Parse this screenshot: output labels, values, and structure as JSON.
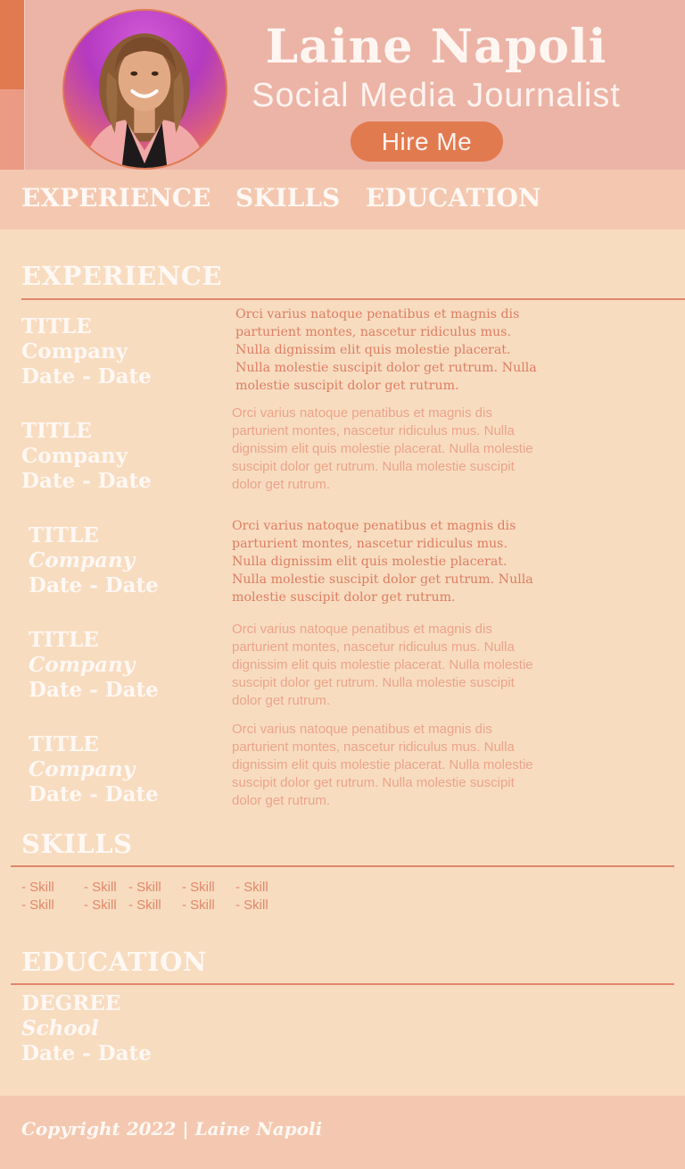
{
  "header": {
    "name": "Laine Napoli",
    "role": "Social Media Journalist",
    "hire_label": "Hire Me",
    "avatar_icon": "profile-photo"
  },
  "nav": {
    "items": [
      {
        "label": "EXPERIENCE"
      },
      {
        "label": "SKILLS"
      },
      {
        "label": "EDUCATION"
      }
    ]
  },
  "experience": {
    "title": "EXPERIENCE",
    "jobs": [
      {
        "title": "TITLE",
        "company": "Company",
        "dates": "Date - Date",
        "description": "Orci varius natoque penatibus et magnis dis parturient montes, nascetur ridiculus mus. Nulla dignissim elit quis molestie placerat. Nulla molestie suscipit dolor get rutrum. Nulla molestie suscipit dolor get rutrum."
      },
      {
        "title": "TITLE",
        "company": "Company",
        "dates": "Date - Date",
        "description": "Orci varius natoque penatibus et magnis dis parturient montes, nascetur ridiculus mus. Nulla dignissim elit quis molestie placerat. Nulla molestie suscipit dolor get rutrum. Nulla molestie suscipit dolor get rutrum."
      },
      {
        "title": "TITLE",
        "company": "Company",
        "dates": "Date - Date",
        "description": "Orci varius natoque penatibus et magnis dis parturient montes, nascetur ridiculus mus. Nulla dignissim elit quis molestie placerat. Nulla molestie suscipit dolor get rutrum. Nulla molestie suscipit dolor get rutrum."
      },
      {
        "title": "TITLE",
        "company": "Company",
        "dates": "Date - Date",
        "description": "Orci varius natoque penatibus et magnis dis parturient montes, nascetur ridiculus mus. Nulla dignissim elit quis molestie placerat. Nulla molestie suscipit dolor get rutrum. Nulla molestie suscipit dolor get rutrum."
      },
      {
        "title": "TITLE",
        "company": "Company",
        "dates": "Date - Date",
        "description": "Orci varius natoque penatibus et magnis dis parturient montes, nascetur ridiculus mus. Nulla dignissim elit quis molestie placerat. Nulla molestie suscipit dolor get rutrum. Nulla molestie suscipit dolor get rutrum."
      }
    ]
  },
  "skills": {
    "title": "SKILLS",
    "items": [
      "- Skill",
      "- Skill",
      "- Skill",
      "- Skill",
      "- Skill",
      "- Skill",
      "- Skill",
      "- Skill",
      "- Skill",
      "- Skill"
    ]
  },
  "education": {
    "title": "EDUCATION",
    "degree": "DEGREE",
    "school": "School",
    "dates": "Date - Date"
  },
  "footer": {
    "copyright": "Copyright 2022 | Laine Napoli"
  },
  "colors": {
    "accent": "#e27a50",
    "header_bg": "#ecb4a6",
    "page_bg": "#f8dcc0",
    "nav_bg": "#f4c8b0"
  }
}
